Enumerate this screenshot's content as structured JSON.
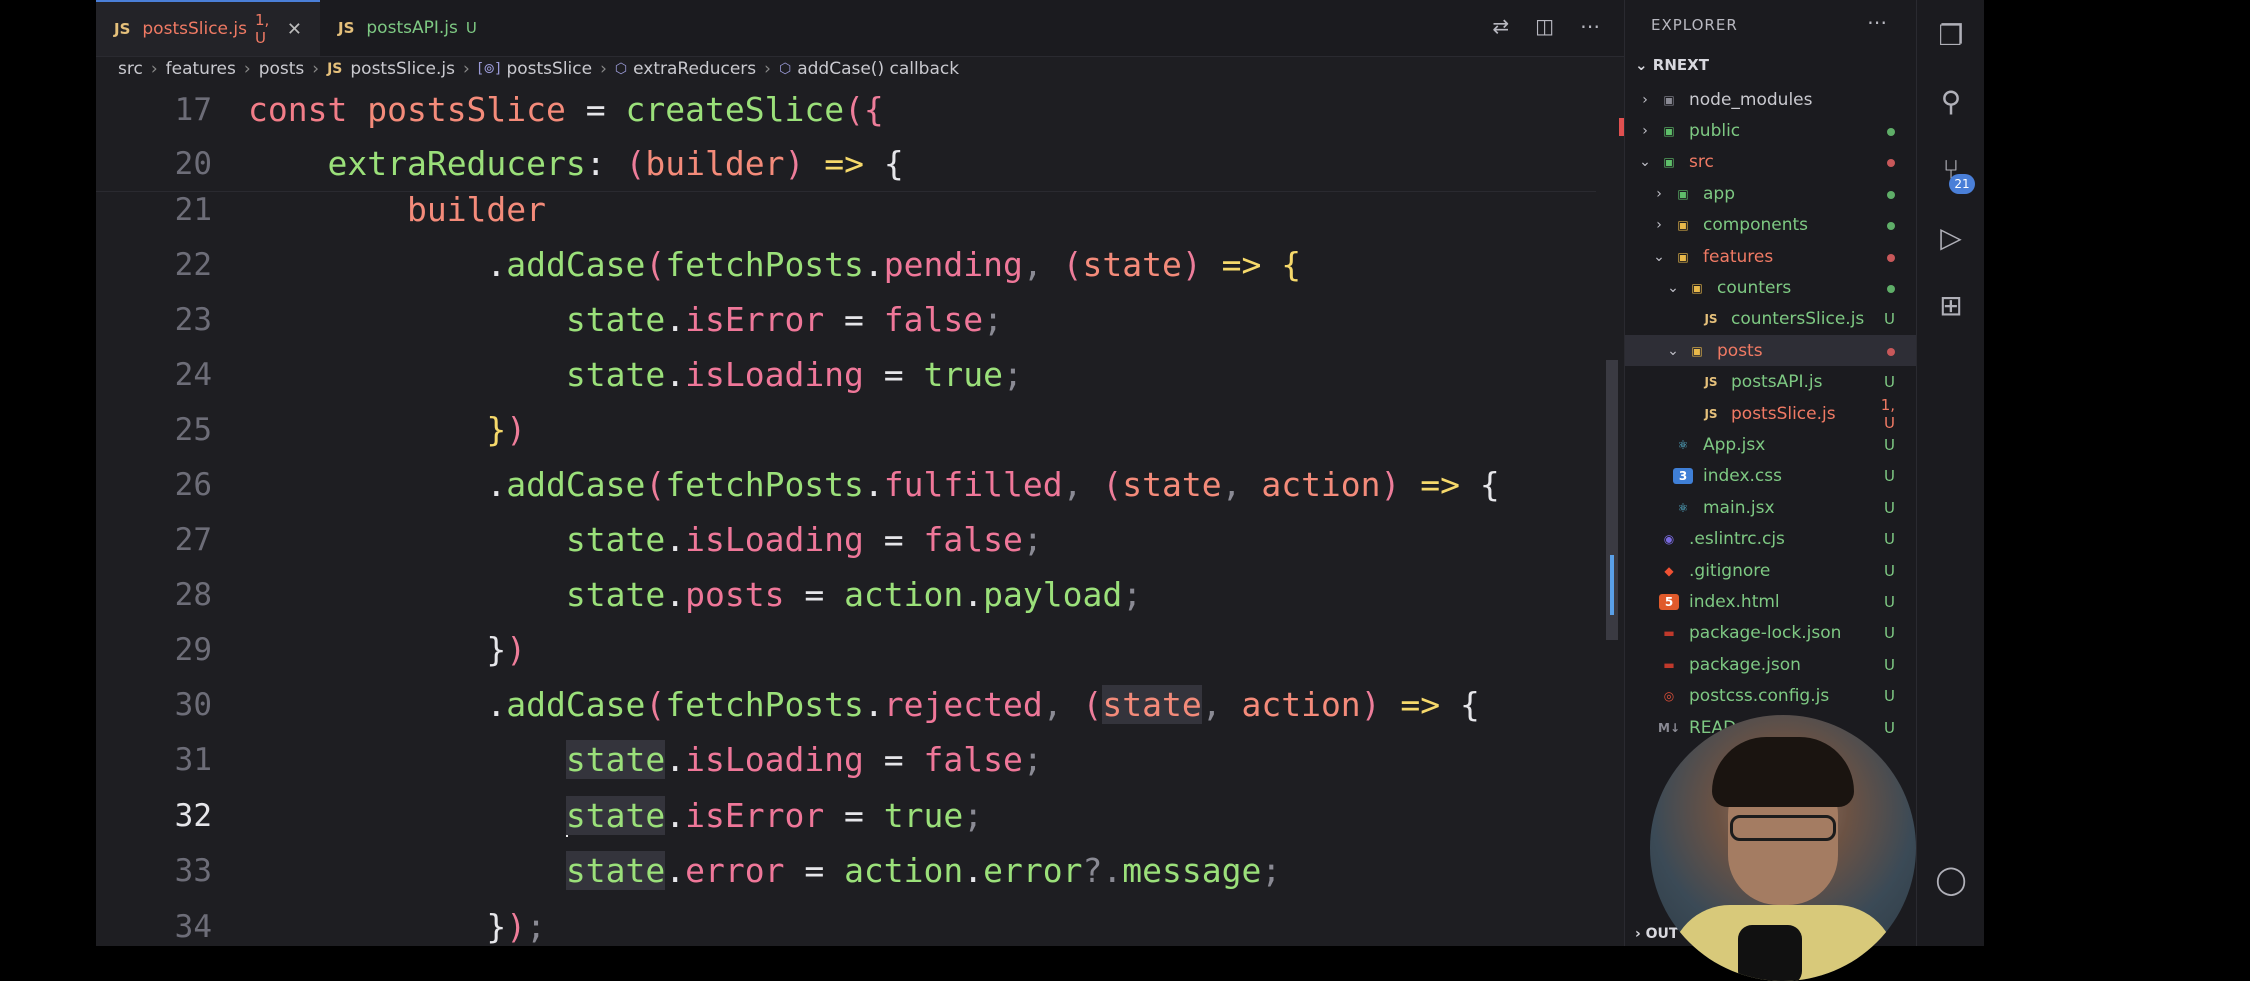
{
  "tabs": [
    {
      "label": "postsSlice.js",
      "meta": "1, U",
      "active": true
    },
    {
      "label": "postsAPI.js",
      "meta": "U",
      "active": false
    }
  ],
  "breadcrumb": [
    "src",
    "features",
    "posts",
    "postsSlice.js",
    "postsSlice",
    "extraReducers",
    "addCase() callback"
  ],
  "editor": {
    "sticky": [
      {
        "n": "17",
        "tokens": [
          [
            "k",
            "const "
          ],
          [
            "v",
            "postsSlice"
          ],
          [
            "p",
            " = "
          ],
          [
            "fn",
            "createSlice"
          ],
          [
            "br",
            "({"
          ]
        ]
      },
      {
        "n": "20",
        "tokens": [
          [
            "p",
            "    "
          ],
          [
            "fn",
            "extraReducers"
          ],
          [
            "p",
            ": "
          ],
          [
            "br",
            "("
          ],
          [
            "v",
            "builder"
          ],
          [
            "br",
            ")"
          ],
          [
            "ar",
            " => "
          ],
          [
            "p",
            "{"
          ]
        ]
      }
    ],
    "lines": [
      {
        "n": "21",
        "tokens": [
          [
            "p",
            "        "
          ],
          [
            "v",
            "builder"
          ]
        ]
      },
      {
        "n": "22",
        "tokens": [
          [
            "p",
            "            ."
          ],
          [
            "fn",
            "addCase"
          ],
          [
            "br",
            "("
          ],
          [
            "fn",
            "fetchPosts"
          ],
          [
            "p",
            "."
          ],
          [
            "prop",
            "pending"
          ],
          [
            "pl",
            ", "
          ],
          [
            "br",
            "("
          ],
          [
            "v",
            "state"
          ],
          [
            "br",
            ")"
          ],
          [
            "ar",
            " => "
          ],
          [
            "ar",
            "{"
          ]
        ]
      },
      {
        "n": "23",
        "tokens": [
          [
            "p",
            "                "
          ],
          [
            "fn",
            "state"
          ],
          [
            "p",
            "."
          ],
          [
            "prop",
            "isError"
          ],
          [
            "p",
            " = "
          ],
          [
            "prop",
            "false"
          ],
          [
            "pl",
            ";"
          ]
        ]
      },
      {
        "n": "24",
        "tokens": [
          [
            "p",
            "                "
          ],
          [
            "fn",
            "state"
          ],
          [
            "p",
            "."
          ],
          [
            "prop",
            "isLoading"
          ],
          [
            "p",
            " = "
          ],
          [
            "fn",
            "true"
          ],
          [
            "pl",
            ";"
          ]
        ]
      },
      {
        "n": "25",
        "tokens": [
          [
            "p",
            "            "
          ],
          [
            "ar",
            "}"
          ],
          [
            "br",
            ")"
          ]
        ]
      },
      {
        "n": "26",
        "tokens": [
          [
            "p",
            "            ."
          ],
          [
            "fn",
            "addCase"
          ],
          [
            "br",
            "("
          ],
          [
            "fn",
            "fetchPosts"
          ],
          [
            "p",
            "."
          ],
          [
            "prop",
            "fulfilled"
          ],
          [
            "pl",
            ", "
          ],
          [
            "br",
            "("
          ],
          [
            "v",
            "state"
          ],
          [
            "pl",
            ", "
          ],
          [
            "v",
            "action"
          ],
          [
            "br",
            ")"
          ],
          [
            "ar",
            " => "
          ],
          [
            "p",
            "{"
          ]
        ]
      },
      {
        "n": "27",
        "tokens": [
          [
            "p",
            "                "
          ],
          [
            "fn",
            "state"
          ],
          [
            "p",
            "."
          ],
          [
            "prop",
            "isLoading"
          ],
          [
            "p",
            " = "
          ],
          [
            "prop",
            "false"
          ],
          [
            "pl",
            ";"
          ]
        ]
      },
      {
        "n": "28",
        "tokens": [
          [
            "p",
            "                "
          ],
          [
            "fn",
            "state"
          ],
          [
            "p",
            "."
          ],
          [
            "prop",
            "posts"
          ],
          [
            "p",
            " = "
          ],
          [
            "fn",
            "action"
          ],
          [
            "p",
            "."
          ],
          [
            "fn",
            "payload"
          ],
          [
            "pl",
            ";"
          ]
        ]
      },
      {
        "n": "29",
        "tokens": [
          [
            "p",
            "            "
          ],
          [
            "p",
            "}"
          ],
          [
            "br",
            ")"
          ]
        ]
      },
      {
        "n": "30",
        "tokens": [
          [
            "p",
            "            ."
          ],
          [
            "fn",
            "addCase"
          ],
          [
            "br",
            "("
          ],
          [
            "fn",
            "fetchPosts"
          ],
          [
            "p",
            "."
          ],
          [
            "prop",
            "rejected"
          ],
          [
            "pl",
            ", "
          ],
          [
            "br",
            "("
          ],
          [
            "hlv",
            "state"
          ],
          [
            "pl",
            ", "
          ],
          [
            "v",
            "action"
          ],
          [
            "br",
            ")"
          ],
          [
            "ar",
            " => "
          ],
          [
            "p",
            "{"
          ]
        ]
      },
      {
        "n": "31",
        "tokens": [
          [
            "p",
            "                "
          ],
          [
            "hlf",
            "state"
          ],
          [
            "p",
            "."
          ],
          [
            "prop",
            "isLoading"
          ],
          [
            "p",
            " = "
          ],
          [
            "prop",
            "false"
          ],
          [
            "pl",
            ";"
          ]
        ]
      },
      {
        "n": "32",
        "tokens": [
          [
            "p",
            "                "
          ],
          [
            "cur",
            ""
          ],
          [
            "hlf",
            "state"
          ],
          [
            "p",
            "."
          ],
          [
            "prop",
            "isError"
          ],
          [
            "p",
            " = "
          ],
          [
            "fn",
            "true"
          ],
          [
            "pl",
            ";"
          ]
        ],
        "current": true
      },
      {
        "n": "33",
        "tokens": [
          [
            "p",
            "                "
          ],
          [
            "hlf",
            "state"
          ],
          [
            "p",
            "."
          ],
          [
            "prop",
            "error"
          ],
          [
            "p",
            " = "
          ],
          [
            "fn",
            "action"
          ],
          [
            "p",
            "."
          ],
          [
            "fn",
            "error"
          ],
          [
            "pl",
            "?."
          ],
          [
            "fn",
            "message"
          ],
          [
            "pl",
            ";"
          ]
        ]
      },
      {
        "n": "34",
        "tokens": [
          [
            "p",
            "            "
          ],
          [
            "p",
            "}"
          ],
          [
            "br",
            ")"
          ],
          [
            "pl",
            ";"
          ]
        ]
      }
    ]
  },
  "explorer": {
    "title": "EXPLORER",
    "project": "RNEXT",
    "items": [
      {
        "label": "node_modules",
        "depth": 0,
        "chev": "›",
        "icon": "folder",
        "color": "#c9c9cf",
        "status": ""
      },
      {
        "label": "public",
        "depth": 0,
        "chev": "›",
        "icon": "folder-g",
        "color": "#7ec983",
        "status": "dot-g"
      },
      {
        "label": "src",
        "depth": 0,
        "chev": "⌄",
        "icon": "folder-g",
        "color": "#f07a64",
        "status": "dot-r"
      },
      {
        "label": "app",
        "depth": 1,
        "chev": "›",
        "icon": "folder-g",
        "color": "#7ec983",
        "status": "dot-g"
      },
      {
        "label": "components",
        "depth": 1,
        "chev": "›",
        "icon": "folder-y",
        "color": "#7ec983",
        "status": "dot-g"
      },
      {
        "label": "features",
        "depth": 1,
        "chev": "⌄",
        "icon": "folder-y",
        "color": "#f07a64",
        "status": "dot-r"
      },
      {
        "label": "counters",
        "depth": 2,
        "chev": "⌄",
        "icon": "folder-y",
        "color": "#7ec983",
        "status": "dot-g"
      },
      {
        "label": "countersSlice.js",
        "depth": 3,
        "chev": "",
        "icon": "js",
        "color": "#7ec983",
        "status": "U"
      },
      {
        "label": "posts",
        "depth": 2,
        "chev": "⌄",
        "icon": "folder-y",
        "color": "#f07a64",
        "status": "dot-r",
        "selected": true
      },
      {
        "label": "postsAPI.js",
        "depth": 3,
        "chev": "",
        "icon": "js",
        "color": "#7ec983",
        "status": "U"
      },
      {
        "label": "postsSlice.js",
        "depth": 3,
        "chev": "",
        "icon": "js",
        "color": "#f07a64",
        "status": "1, U"
      },
      {
        "label": "App.jsx",
        "depth": 1,
        "chev": "",
        "icon": "react",
        "color": "#7ec983",
        "status": "U"
      },
      {
        "label": "index.css",
        "depth": 1,
        "chev": "",
        "icon": "css",
        "color": "#7ec983",
        "status": "U"
      },
      {
        "label": "main.jsx",
        "depth": 1,
        "chev": "",
        "icon": "react",
        "color": "#7ec983",
        "status": "U"
      },
      {
        "label": ".eslintrc.cjs",
        "depth": 0,
        "chev": "",
        "icon": "eslint",
        "color": "#7ec983",
        "status": "U"
      },
      {
        "label": ".gitignore",
        "depth": 0,
        "chev": "",
        "icon": "git",
        "color": "#7ec983",
        "status": "U"
      },
      {
        "label": "index.html",
        "depth": 0,
        "chev": "",
        "icon": "html",
        "color": "#7ec983",
        "status": "U"
      },
      {
        "label": "package-lock.json",
        "depth": 0,
        "chev": "",
        "icon": "npm",
        "color": "#7ec983",
        "status": "U"
      },
      {
        "label": "package.json",
        "depth": 0,
        "chev": "",
        "icon": "npm",
        "color": "#7ec983",
        "status": "U"
      },
      {
        "label": "postcss.config.js",
        "depth": 0,
        "chev": "",
        "icon": "postcss",
        "color": "#7ec983",
        "status": "U"
      },
      {
        "label": "READ",
        "depth": 0,
        "chev": "",
        "icon": "md",
        "color": "#7ec983",
        "status": "U"
      }
    ],
    "outline": "OUT"
  },
  "activity": {
    "scm_badge": "21"
  }
}
